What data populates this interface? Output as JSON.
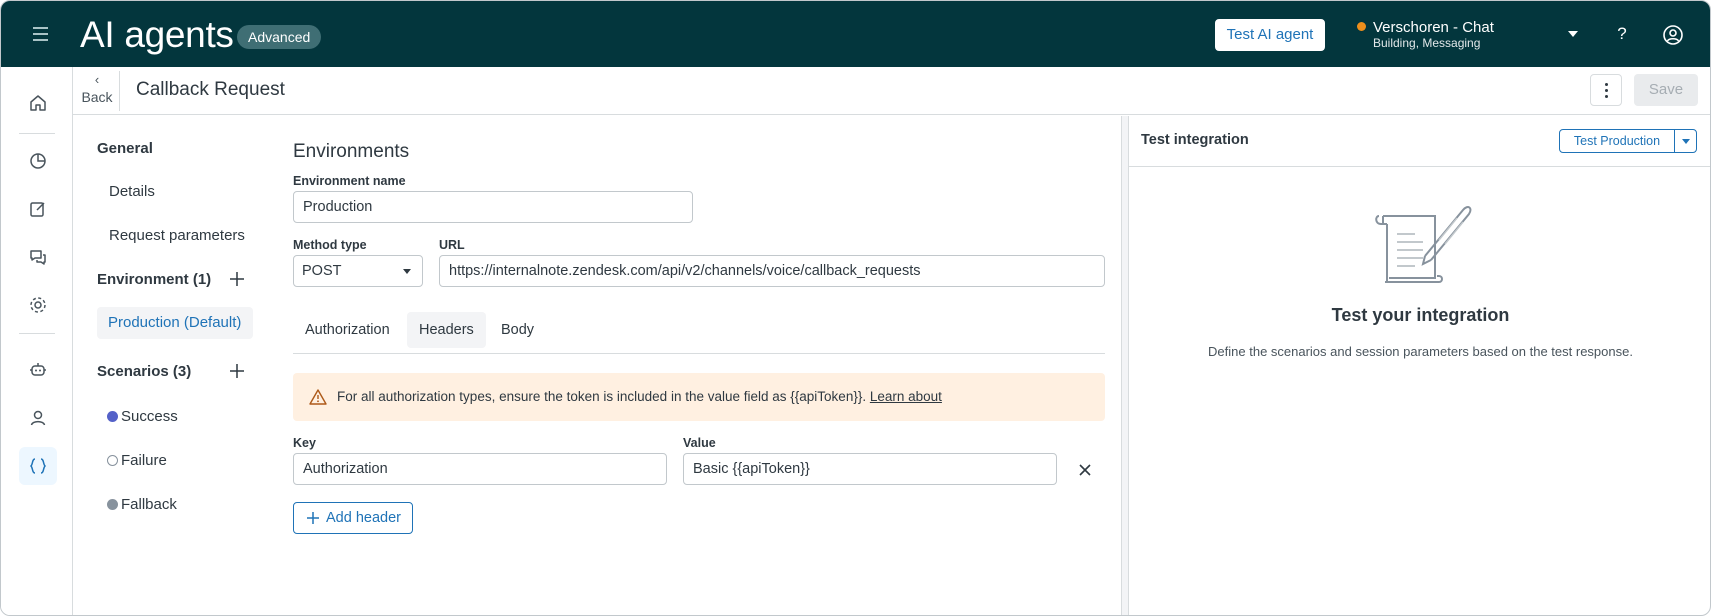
{
  "topbar": {
    "title": "AI agents",
    "badge": "Advanced",
    "test_button": "Test AI agent",
    "workspace_name": "Verschoren - Chat",
    "workspace_sub": "Building, Messaging",
    "workspace_status_color": "#ed8f1c",
    "help_icon": "?"
  },
  "colors": {
    "topbar_bg": "#03363d",
    "accent": "#1f73b7",
    "scenario_success": "#5461c8",
    "scenario_fallback": "#87929d",
    "notice_bg": "#fff0e1"
  },
  "leftnav": {
    "icons": [
      "home-icon",
      "reporting-icon",
      "edit-icon",
      "conversations-icon",
      "settings-icon",
      "bot-icon",
      "user-icon",
      "integrations-icon"
    ],
    "active": "integrations-icon"
  },
  "page": {
    "back_label": "Back",
    "title": "Callback Request",
    "save_label": "Save"
  },
  "sidenav": {
    "general_heading": "General",
    "details": "Details",
    "request_parameters": "Request parameters",
    "environment_heading": "Environment (1)",
    "environment_active": "Production (Default)",
    "scenarios_heading": "Scenarios (3)",
    "scenarios": [
      {
        "label": "Success"
      },
      {
        "label": "Failure"
      },
      {
        "label": "Fallback"
      }
    ]
  },
  "main": {
    "section_title": "Environments",
    "env_name_label": "Environment name",
    "env_name_value": "Production",
    "method_label": "Method type",
    "method_value": "POST",
    "url_label": "URL",
    "url_value": "https://internalnote.zendesk.com/api/v2/channels/voice/callback_requests",
    "tabs": [
      {
        "label": "Authorization"
      },
      {
        "label": "Headers"
      },
      {
        "label": "Body"
      }
    ],
    "active_tab": "Headers",
    "notice_text": "For all authorization types, ensure the token is included in the value field as {{apiToken}}.",
    "notice_link": "Learn about",
    "key_label": "Key",
    "value_label": "Value",
    "header_key": "Authorization",
    "header_value": "Basic {{apiToken}}",
    "add_header": "Add header"
  },
  "right_panel": {
    "title": "Test integration",
    "test_button": "Test Production",
    "empty_title": "Test your integration",
    "empty_desc": "Define the scenarios and session parameters based on the test response."
  }
}
